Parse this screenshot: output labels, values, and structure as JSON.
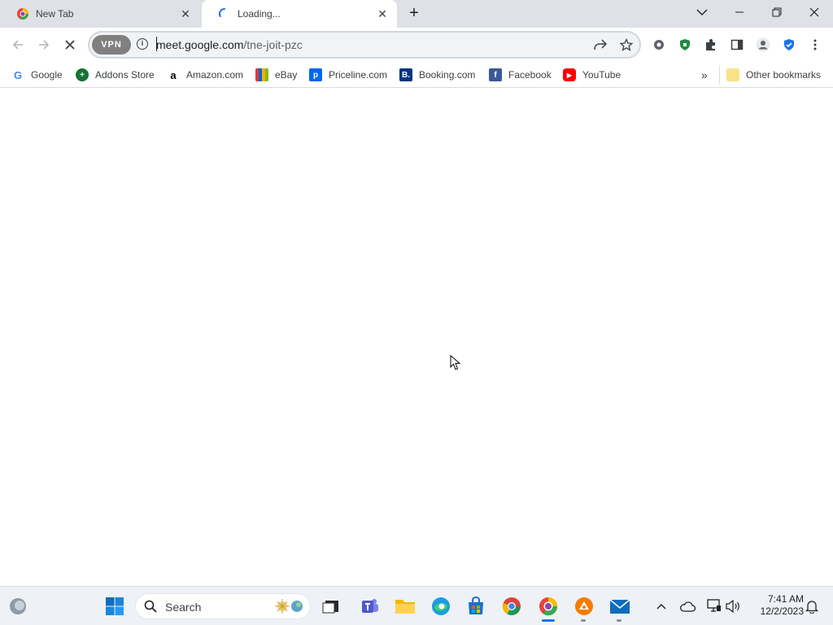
{
  "tabs": [
    {
      "title": "New Tab",
      "state": "inactive"
    },
    {
      "title": "Loading...",
      "state": "active"
    }
  ],
  "omnibox": {
    "vpn_label": "VPN",
    "url_host": "meet.google.com",
    "url_path": "/tne-joit-pzc"
  },
  "bookmarks": [
    {
      "label": "Google",
      "icon": "google-icon"
    },
    {
      "label": "Addons Store",
      "icon": "addons-store-icon"
    },
    {
      "label": "Amazon.com",
      "icon": "amazon-icon"
    },
    {
      "label": "eBay",
      "icon": "ebay-icon"
    },
    {
      "label": "Priceline.com",
      "icon": "priceline-icon"
    },
    {
      "label": "Booking.com",
      "icon": "booking-icon"
    },
    {
      "label": "Facebook",
      "icon": "facebook-icon"
    },
    {
      "label": "YouTube",
      "icon": "youtube-icon"
    }
  ],
  "other_bookmarks": "Other bookmarks",
  "taskbar": {
    "search_placeholder": "Search",
    "time": "7:41 AM",
    "date": "12/2/2023"
  },
  "colors": {
    "tabstrip": "#dee1e6",
    "accent_blue": "#1a73e8",
    "taskbar": "#eef1f5"
  }
}
